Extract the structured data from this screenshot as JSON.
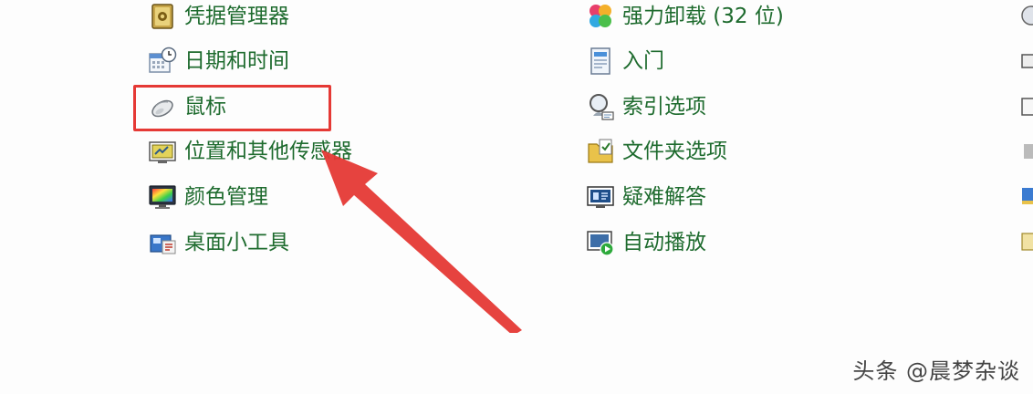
{
  "left_column": [
    {
      "label": "凭据管理器",
      "icon": "credential-vault-icon"
    },
    {
      "label": "日期和时间",
      "icon": "calendar-clock-icon"
    },
    {
      "label": "鼠标",
      "icon": "mouse-icon"
    },
    {
      "label": "位置和其他传感器",
      "icon": "location-sensor-icon"
    },
    {
      "label": "颜色管理",
      "icon": "color-monitor-icon"
    },
    {
      "label": "桌面小工具",
      "icon": "desktop-gadgets-icon"
    }
  ],
  "right_column": [
    {
      "label": "强力卸载 (32 位)",
      "icon": "clover-uninstall-icon"
    },
    {
      "label": "入门",
      "icon": "getting-started-icon"
    },
    {
      "label": "索引选项",
      "icon": "indexing-search-icon"
    },
    {
      "label": "文件夹选项",
      "icon": "folder-options-icon"
    },
    {
      "label": "疑难解答",
      "icon": "troubleshooting-icon"
    },
    {
      "label": "自动播放",
      "icon": "autoplay-icon"
    }
  ],
  "annotation": {
    "highlight_color": "#e53935",
    "highlighted_item": "鼠标"
  },
  "watermark": "头条 @晨梦杂谈",
  "colors": {
    "link_text": "#1e6b2e",
    "background": "#fdfdfd"
  }
}
